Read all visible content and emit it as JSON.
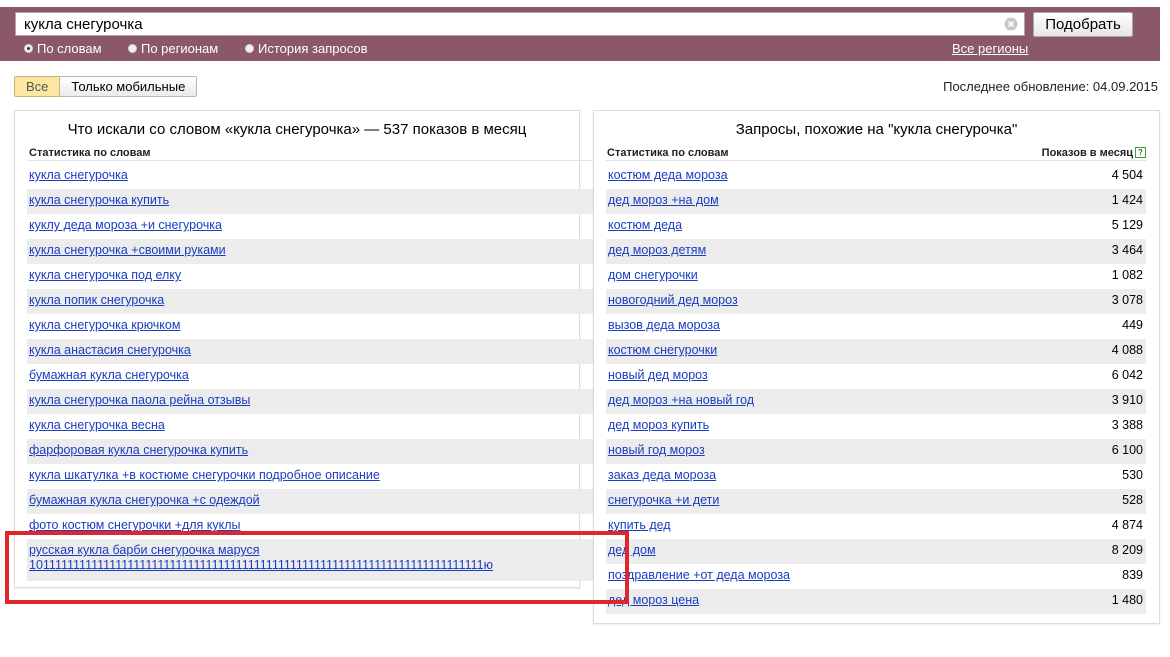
{
  "search": {
    "query": "кукла снегурочка",
    "submit_label": "Подобрать",
    "modes": [
      {
        "label": "По словам",
        "selected": true
      },
      {
        "label": "По регионам",
        "selected": false
      },
      {
        "label": "История запросов",
        "selected": false
      }
    ],
    "regions_link": "Все регионы"
  },
  "tabs": {
    "all_label": "Все",
    "mobile_label": "Только мобильные",
    "active": "all"
  },
  "last_update": "Последнее обновление: 04.09.2015",
  "left_panel": {
    "title": "Что искали со словом «кукла снегурочка» — 537 показов в месяц",
    "column_header": "Статистика по словам",
    "rows": [
      "кукла снегурочка",
      "кукла снегурочка купить",
      "куклу деда мороза +и снегурочка",
      "кукла снегурочка +своими руками",
      "кукла снегурочка под елку",
      "кукла попик снегурочка",
      "кукла снегурочка крючком",
      "кукла анастасия снегурочка",
      "бумажная кукла снегурочка",
      "кукла снегурочка паола рейна отзывы",
      "кукла снегурочка весна",
      "фарфоровая кукла снегурочка купить",
      "кукла шкатулка +в костюме снегурочки подробное описание",
      "бумажная кукла снегурочка +с одеждой",
      "фото костюм снегурочки +для куклы"
    ],
    "last_row_line1": "русская кукла барби снегурочка маруся",
    "last_row_line2": "101111111111111111111111111111111111111111111111111111111111111111111111111ю"
  },
  "right_panel": {
    "title": "Запросы, похожие на \"кукла снегурочка\"",
    "column_header": "Статистика по словам",
    "count_header": "Показов в месяц",
    "help_glyph": "?",
    "rows": [
      {
        "phrase": "костюм деда мороза",
        "count": "4 504"
      },
      {
        "phrase": "дед мороз +на дом",
        "count": "1 424"
      },
      {
        "phrase": "костюм деда",
        "count": "5 129"
      },
      {
        "phrase": "дед мороз детям",
        "count": "3 464"
      },
      {
        "phrase": "дом снегурочки",
        "count": "1 082"
      },
      {
        "phrase": "новогодний дед мороз",
        "count": "3 078"
      },
      {
        "phrase": "вызов деда мороза",
        "count": "449"
      },
      {
        "phrase": "костюм снегурочки",
        "count": "4 088"
      },
      {
        "phrase": "новый дед мороз",
        "count": "6 042"
      },
      {
        "phrase": "дед мороз +на новый год",
        "count": "3 910"
      },
      {
        "phrase": "дед мороз купить",
        "count": "3 388"
      },
      {
        "phrase": "новый год мороз",
        "count": "6 100"
      },
      {
        "phrase": "заказ деда мороза",
        "count": "530"
      },
      {
        "phrase": "снегурочка +и дети",
        "count": "528"
      },
      {
        "phrase": "купить дед",
        "count": "4 874"
      },
      {
        "phrase": "дед дом",
        "count": "8 209"
      },
      {
        "phrase": "поздравление +от деда мороза",
        "count": "839"
      },
      {
        "phrase": "дед мороз цена",
        "count": "1 480"
      }
    ]
  },
  "colors": {
    "header_band": "#8a5869",
    "link": "#1a3dc1",
    "row_stripe": "#ececec",
    "active_tab": "#fbe7a1",
    "highlight_frame": "#e0252b"
  }
}
